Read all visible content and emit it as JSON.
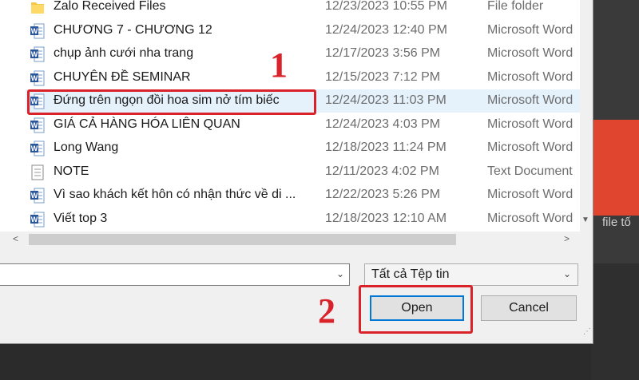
{
  "background": {
    "partial_text": "file tố"
  },
  "files": [
    {
      "name": "Zalo Received Files",
      "date": "12/23/2023 10:55 PM",
      "type": "File folder",
      "icon": "folder-icon"
    },
    {
      "name": "CHƯƠNG 7 - CHƯƠNG 12",
      "date": "12/24/2023 12:40 PM",
      "type": "Microsoft Word",
      "icon": "word-doc-icon"
    },
    {
      "name": "chụp ảnh cưới nha trang",
      "date": "12/17/2023 3:56 PM",
      "type": "Microsoft Word",
      "icon": "word-doc-icon"
    },
    {
      "name": "CHUYÊN ĐỀ SEMINAR",
      "date": "12/15/2023 7:12 PM",
      "type": "Microsoft Word",
      "icon": "word-doc-icon"
    },
    {
      "name": "Đứng trên ngọn đồi hoa sim nở tím biếc",
      "date": "12/24/2023 11:03 PM",
      "type": "Microsoft Word",
      "icon": "word-doc-icon"
    },
    {
      "name": "GIÁ CẢ HÀNG HÓA LIÊN QUAN",
      "date": "12/24/2023 4:03 PM",
      "type": "Microsoft Word",
      "icon": "word-doc-icon"
    },
    {
      "name": "Long Wang",
      "date": "12/18/2023 11:24 PM",
      "type": "Microsoft Word",
      "icon": "word-doc-icon"
    },
    {
      "name": "NOTE",
      "date": "12/11/2023 4:02 PM",
      "type": "Text Document",
      "icon": "text-doc-icon"
    },
    {
      "name": "Vì sao khách kết hôn có nhận thức về di ...",
      "date": "12/22/2023 5:26 PM",
      "type": "Microsoft Word",
      "icon": "word-doc-icon"
    },
    {
      "name": "Viết top 3",
      "date": "12/18/2023 12:10 AM",
      "type": "Microsoft Word",
      "icon": "word-doc-icon"
    }
  ],
  "selected_index": 4,
  "filename_value": "",
  "file_type_filter": "Tất cả Tệp tin",
  "buttons": {
    "open": "Open",
    "cancel": "Cancel"
  },
  "annotations": {
    "step1": "1",
    "step2": "2"
  },
  "colors": {
    "annotation": "#d9222a",
    "selection": "#e5f1fb",
    "word_blue": "#2b579a",
    "folder": "#f5c84c"
  }
}
